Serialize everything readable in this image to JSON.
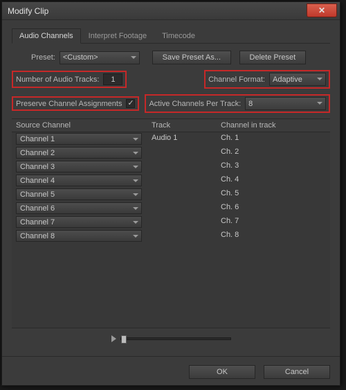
{
  "window": {
    "title": "Modify Clip"
  },
  "tabs": {
    "t0": "Audio Channels",
    "t1": "Interpret Footage",
    "t2": "Timecode"
  },
  "preset": {
    "label": "Preset:",
    "value": "<Custom>",
    "save": "Save Preset As...",
    "delete": "Delete Preset"
  },
  "fields": {
    "numTracksLabel": "Number of Audio Tracks:",
    "numTracksValue": "1",
    "chFormatLabel": "Channel Format:",
    "chFormatValue": "Adaptive",
    "preserveLabel": "Preserve Channel Assignments",
    "preserveChecked": "✓",
    "activePerTrackLabel": "Active Channels Per Track:",
    "activePerTrackValue": "8"
  },
  "table": {
    "head": {
      "src": "Source Channel",
      "trk": "Track",
      "cht": "Channel in track"
    },
    "rows": [
      {
        "src": "Channel 1",
        "trk": "Audio 1",
        "cht": "Ch. 1"
      },
      {
        "src": "Channel 2",
        "trk": "",
        "cht": "Ch. 2"
      },
      {
        "src": "Channel 3",
        "trk": "",
        "cht": "Ch. 3"
      },
      {
        "src": "Channel 4",
        "trk": "",
        "cht": "Ch. 4"
      },
      {
        "src": "Channel 5",
        "trk": "",
        "cht": "Ch. 5"
      },
      {
        "src": "Channel 6",
        "trk": "",
        "cht": "Ch. 6"
      },
      {
        "src": "Channel 7",
        "trk": "",
        "cht": "Ch. 7"
      },
      {
        "src": "Channel 8",
        "trk": "",
        "cht": "Ch. 8"
      }
    ]
  },
  "footer": {
    "ok": "OK",
    "cancel": "Cancel"
  }
}
